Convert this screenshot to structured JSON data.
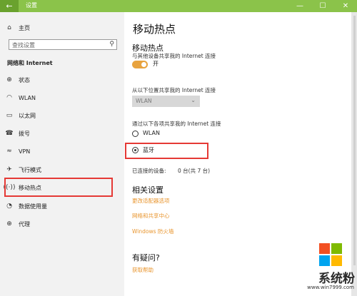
{
  "window": {
    "title": "设置",
    "back_icon": "back-arrow-icon",
    "accent": "#8bc34a"
  },
  "sidebar": {
    "home_label": "主页",
    "search_placeholder": "查找设置",
    "section_title": "网络和 Internet",
    "items": [
      {
        "label": "状态",
        "icon": "globe-icon"
      },
      {
        "label": "WLAN",
        "icon": "wifi-icon"
      },
      {
        "label": "以太网",
        "icon": "ethernet-icon"
      },
      {
        "label": "拨号",
        "icon": "dialup-icon"
      },
      {
        "label": "VPN",
        "icon": "vpn-icon"
      },
      {
        "label": "飞行模式",
        "icon": "airplane-icon"
      },
      {
        "label": "移动热点",
        "icon": "hotspot-icon",
        "selected": true
      },
      {
        "label": "数据使用量",
        "icon": "data-usage-icon"
      },
      {
        "label": "代理",
        "icon": "proxy-globe-icon"
      }
    ]
  },
  "main": {
    "page_title": "移动热点",
    "hotspot": {
      "heading": "移动热点",
      "desc": "与其他设备共享我的 Internet 连接",
      "toggle_state": "开"
    },
    "share_from": {
      "label": "从以下位置共享我的 Internet 连接",
      "selected": "WLAN"
    },
    "share_over": {
      "label": "通过以下各项共享我的 Internet 连接",
      "options": [
        {
          "label": "WLAN",
          "selected": false
        },
        {
          "label": "蓝牙",
          "selected": true
        }
      ]
    },
    "connected": {
      "label": "已连接的设备:",
      "value": "0 台(共 7 台)"
    },
    "related": {
      "heading": "相关设置",
      "links": [
        "更改适配器选项",
        "网络和共享中心",
        "Windows 防火墙"
      ]
    },
    "help": {
      "heading": "有疑问?",
      "link": "获取帮助"
    }
  },
  "watermark": {
    "text": "系统粉",
    "url": "www.win7999.com"
  }
}
